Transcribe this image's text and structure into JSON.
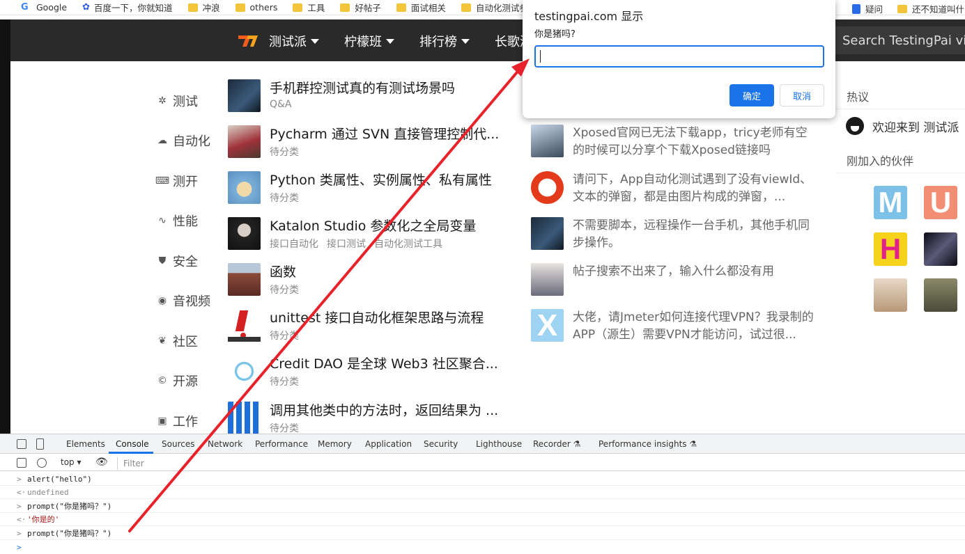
{
  "bookmarks": [
    {
      "label": "Google",
      "icon": "google-icon"
    },
    {
      "label": "百度一下，你就知道",
      "icon": "baidu-icon"
    },
    {
      "label": "冲浪",
      "icon": "folder-icon"
    },
    {
      "label": "others",
      "icon": "folder-icon"
    },
    {
      "label": "工具",
      "icon": "folder-icon"
    },
    {
      "label": "好帖子",
      "icon": "folder-icon"
    },
    {
      "label": "面试相关",
      "icon": "folder-icon"
    },
    {
      "label": "自动化测试参考资料",
      "icon": "folder-icon"
    },
    {
      "label": "疑问",
      "icon": "doc-icon"
    },
    {
      "label": "还不知道叫什么",
      "icon": "folder-icon"
    }
  ],
  "nav": {
    "items": [
      "测试派",
      "柠檬班",
      "排行榜",
      "长歌测"
    ],
    "search_placeholder": "Search TestingPai via"
  },
  "categories": [
    "测试",
    "自动化",
    "测开",
    "性能",
    "安全",
    "音视频",
    "社区",
    "开源",
    "工作"
  ],
  "posts": [
    {
      "title": "手机群控测试真的有测试场景吗",
      "tags": [
        "Q&A"
      ]
    },
    {
      "title": "Pycharm 通过 SVN 直接管理控制代...",
      "tags": [
        "待分类"
      ]
    },
    {
      "title": "Python 类属性、实例属性、私有属性",
      "tags": [
        "待分类"
      ]
    },
    {
      "title": "Katalon Studio 参数化之全局变量",
      "tags": [
        "接口自动化",
        "接口测试",
        "自动化测试工具"
      ]
    },
    {
      "title": "函数",
      "tags": [
        "待分类"
      ]
    },
    {
      "title": "unittest 接口自动化框架思路与流程",
      "tags": [
        "待分类"
      ]
    },
    {
      "title": "Credit DAO 是全球 Web3 社区聚合...",
      "tags": [
        "待分类"
      ]
    },
    {
      "title": "调用其他类中的方法时，返回结果为 ...",
      "tags": [
        "待分类"
      ]
    }
  ],
  "right_posts": [
    {
      "title": "Xposed官网已无法下载app，tricy老师有空的时候可以分享个下载Xposed链接吗"
    },
    {
      "title": "请问下，App自动化测试遇到了没有viewId、文本的弹窗，都是由图片构成的弹窗，..."
    },
    {
      "title": "不需要脚本，远程操作一台手机，其他手机同步操作。"
    },
    {
      "title": "帖子搜索不出来了，输入什么都没有用"
    },
    {
      "title": "大佬，请Jmeter如何连接代理VPN？我录制的APP（源生）需要VPN才能访问，试过很..."
    }
  ],
  "sidebar": {
    "hot_label": "热议",
    "welcome": "欢迎来到 测试派",
    "new_members_label": "刚加入的伙伴",
    "avatars": [
      "M",
      "U",
      "H",
      "",
      "",
      ""
    ]
  },
  "dialog": {
    "title": "testingpai.com 显示",
    "message": "你是猪吗?",
    "input_value": "",
    "ok_label": "确定",
    "cancel_label": "取消"
  },
  "devtools": {
    "tabs": [
      "Elements",
      "Console",
      "Sources",
      "Network",
      "Performance",
      "Memory",
      "Application",
      "Security",
      "Lighthouse",
      "Recorder",
      "Performance insights"
    ],
    "active_tab": "Console",
    "context": "top",
    "filter_placeholder": "Filter",
    "lines": [
      {
        "type": "input",
        "text": "alert(\"hello\")"
      },
      {
        "type": "return",
        "text": "undefined"
      },
      {
        "type": "input",
        "text": "prompt(\"你是猪吗？\")"
      },
      {
        "type": "return-str",
        "text": "'你是的'"
      },
      {
        "type": "input",
        "text": "prompt(\"你是猪吗？\")"
      }
    ]
  },
  "colors": {
    "navbar": "#2a2a2a",
    "accent": "#1a73e8",
    "annotation_arrow": "#e8222a",
    "logo_orange": "#f25c1c"
  }
}
